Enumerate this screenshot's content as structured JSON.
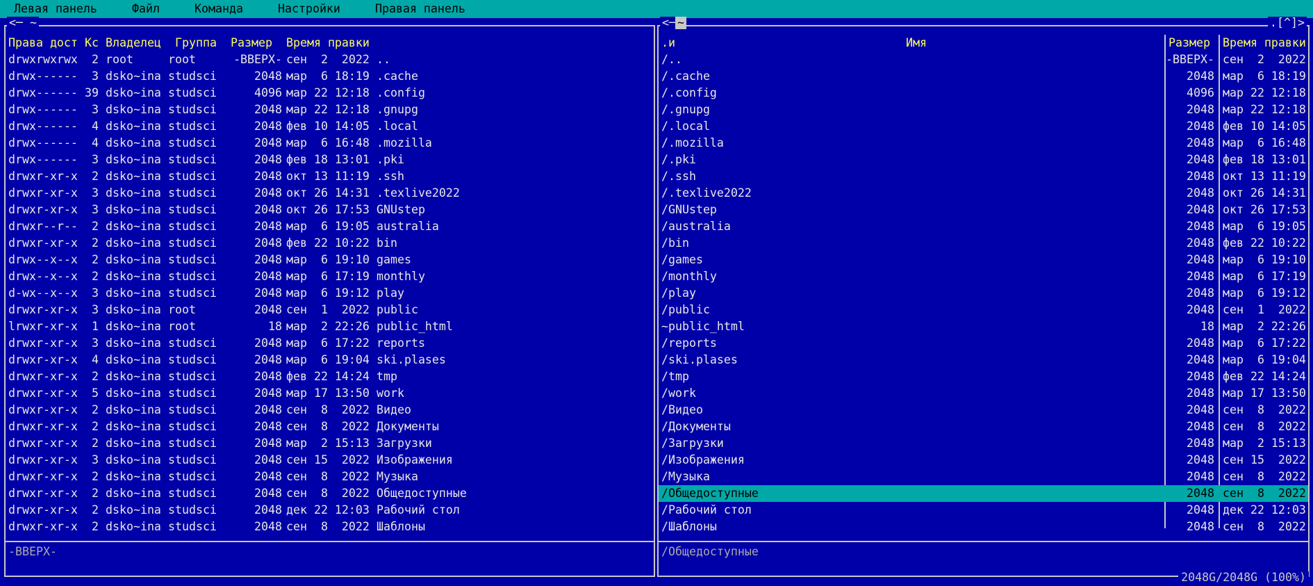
{
  "menubar": {
    "items": [
      "Левая панель",
      "Файл",
      "Команда",
      "Настройки",
      "Правая панель"
    ]
  },
  "left_panel": {
    "title": "<─ ~",
    "headers": {
      "perms": "Права дост",
      "links": "Кс",
      "owner": "Владелец",
      "group": "Группа",
      "size": "Размер",
      "mtime": "Время правки"
    },
    "rows": [
      {
        "perms": "drwxrwxrwx",
        "links": "2",
        "owner": "root",
        "group": "root",
        "size": "-ВВЕРХ-",
        "date": "сен  2  2022",
        "name": ".."
      },
      {
        "perms": "drwx------",
        "links": "3",
        "owner": "dsko~ina",
        "group": "studsci",
        "size": "2048",
        "date": "мар  6 18:19",
        "name": ".cache"
      },
      {
        "perms": "drwx------",
        "links": "39",
        "owner": "dsko~ina",
        "group": "studsci",
        "size": "4096",
        "date": "мар 22 12:18",
        "name": ".config"
      },
      {
        "perms": "drwx------",
        "links": "3",
        "owner": "dsko~ina",
        "group": "studsci",
        "size": "2048",
        "date": "мар 22 12:18",
        "name": ".gnupg"
      },
      {
        "perms": "drwx------",
        "links": "4",
        "owner": "dsko~ina",
        "group": "studsci",
        "size": "2048",
        "date": "фев 10 14:05",
        "name": ".local"
      },
      {
        "perms": "drwx------",
        "links": "4",
        "owner": "dsko~ina",
        "group": "studsci",
        "size": "2048",
        "date": "мар  6 16:48",
        "name": ".mozilla"
      },
      {
        "perms": "drwx------",
        "links": "3",
        "owner": "dsko~ina",
        "group": "studsci",
        "size": "2048",
        "date": "фев 18 13:01",
        "name": ".pki"
      },
      {
        "perms": "drwxr-xr-x",
        "links": "2",
        "owner": "dsko~ina",
        "group": "studsci",
        "size": "2048",
        "date": "окт 13 11:19",
        "name": ".ssh"
      },
      {
        "perms": "drwxr-xr-x",
        "links": "3",
        "owner": "dsko~ina",
        "group": "studsci",
        "size": "2048",
        "date": "окт 26 14:31",
        "name": ".texlive2022"
      },
      {
        "perms": "drwxr-xr-x",
        "links": "3",
        "owner": "dsko~ina",
        "group": "studsci",
        "size": "2048",
        "date": "окт 26 17:53",
        "name": "GNUstep"
      },
      {
        "perms": "drwxr--r--",
        "links": "2",
        "owner": "dsko~ina",
        "group": "studsci",
        "size": "2048",
        "date": "мар  6 19:05",
        "name": "australia"
      },
      {
        "perms": "drwxr-xr-x",
        "links": "2",
        "owner": "dsko~ina",
        "group": "studsci",
        "size": "2048",
        "date": "фев 22 10:22",
        "name": "bin"
      },
      {
        "perms": "drwx--x--x",
        "links": "2",
        "owner": "dsko~ina",
        "group": "studsci",
        "size": "2048",
        "date": "мар  6 19:10",
        "name": "games"
      },
      {
        "perms": "drwx--x--x",
        "links": "2",
        "owner": "dsko~ina",
        "group": "studsci",
        "size": "2048",
        "date": "мар  6 17:19",
        "name": "monthly"
      },
      {
        "perms": "d-wx--x--x",
        "links": "3",
        "owner": "dsko~ina",
        "group": "studsci",
        "size": "2048",
        "date": "мар  6 19:12",
        "name": "play"
      },
      {
        "perms": "drwxr-xr-x",
        "links": "3",
        "owner": "dsko~ina",
        "group": "root",
        "size": "2048",
        "date": "сен  1  2022",
        "name": "public"
      },
      {
        "perms": "lrwxr-xr-x",
        "links": "1",
        "owner": "dsko~ina",
        "group": "root",
        "size": "18",
        "date": "мар  2 22:26",
        "name": "public_html"
      },
      {
        "perms": "drwxr-xr-x",
        "links": "3",
        "owner": "dsko~ina",
        "group": "studsci",
        "size": "2048",
        "date": "мар  6 17:22",
        "name": "reports"
      },
      {
        "perms": "drwxr-xr-x",
        "links": "4",
        "owner": "dsko~ina",
        "group": "studsci",
        "size": "2048",
        "date": "мар  6 19:04",
        "name": "ski.plases"
      },
      {
        "perms": "drwxr-xr-x",
        "links": "2",
        "owner": "dsko~ina",
        "group": "studsci",
        "size": "2048",
        "date": "фев 22 14:24",
        "name": "tmp"
      },
      {
        "perms": "drwxr-xr-x",
        "links": "5",
        "owner": "dsko~ina",
        "group": "studsci",
        "size": "2048",
        "date": "мар 17 13:50",
        "name": "work"
      },
      {
        "perms": "drwxr-xr-x",
        "links": "2",
        "owner": "dsko~ina",
        "group": "studsci",
        "size": "2048",
        "date": "сен  8  2022",
        "name": "Видео"
      },
      {
        "perms": "drwxr-xr-x",
        "links": "2",
        "owner": "dsko~ina",
        "group": "studsci",
        "size": "2048",
        "date": "сен  8  2022",
        "name": "Документы"
      },
      {
        "perms": "drwxr-xr-x",
        "links": "2",
        "owner": "dsko~ina",
        "group": "studsci",
        "size": "2048",
        "date": "мар  2 15:13",
        "name": "Загрузки"
      },
      {
        "perms": "drwxr-xr-x",
        "links": "3",
        "owner": "dsko~ina",
        "group": "studsci",
        "size": "2048",
        "date": "сен 15  2022",
        "name": "Изображения"
      },
      {
        "perms": "drwxr-xr-x",
        "links": "2",
        "owner": "dsko~ina",
        "group": "studsci",
        "size": "2048",
        "date": "сен  8  2022",
        "name": "Музыка"
      },
      {
        "perms": "drwxr-xr-x",
        "links": "2",
        "owner": "dsko~ina",
        "group": "studsci",
        "size": "2048",
        "date": "сен  8  2022",
        "name": "Общедоступные"
      },
      {
        "perms": "drwxr-xr-x",
        "links": "2",
        "owner": "dsko~ina",
        "group": "studsci",
        "size": "2048",
        "date": "дек 22 12:03",
        "name": "Рабочий стол"
      },
      {
        "perms": "drwxr-xr-x",
        "links": "2",
        "owner": "dsko~ina",
        "group": "studsci",
        "size": "2048",
        "date": "сен  8  2022",
        "name": "Шаблоны"
      }
    ],
    "mini_status": "-ВВЕРХ-"
  },
  "right_panel": {
    "title_prefix": "<─",
    "title_path": "~",
    "corner": ".[^]>",
    "headers": {
      "sort": ".и",
      "name": "Имя",
      "size": "Размер",
      "mtime": "Время правки"
    },
    "rows": [
      {
        "name": "/..",
        "size": "-ВВЕРХ-",
        "date": "сен  2  2022"
      },
      {
        "name": "/.cache",
        "size": "2048",
        "date": "мар  6 18:19"
      },
      {
        "name": "/.config",
        "size": "4096",
        "date": "мар 22 12:18"
      },
      {
        "name": "/.gnupg",
        "size": "2048",
        "date": "мар 22 12:18"
      },
      {
        "name": "/.local",
        "size": "2048",
        "date": "фев 10 14:05"
      },
      {
        "name": "/.mozilla",
        "size": "2048",
        "date": "мар  6 16:48"
      },
      {
        "name": "/.pki",
        "size": "2048",
        "date": "фев 18 13:01"
      },
      {
        "name": "/.ssh",
        "size": "2048",
        "date": "окт 13 11:19"
      },
      {
        "name": "/.texlive2022",
        "size": "2048",
        "date": "окт 26 14:31"
      },
      {
        "name": "/GNUstep",
        "size": "2048",
        "date": "окт 26 17:53"
      },
      {
        "name": "/australia",
        "size": "2048",
        "date": "мар  6 19:05"
      },
      {
        "name": "/bin",
        "size": "2048",
        "date": "фев 22 10:22"
      },
      {
        "name": "/games",
        "size": "2048",
        "date": "мар  6 19:10"
      },
      {
        "name": "/monthly",
        "size": "2048",
        "date": "мар  6 17:19"
      },
      {
        "name": "/play",
        "size": "2048",
        "date": "мар  6 19:12"
      },
      {
        "name": "/public",
        "size": "2048",
        "date": "сен  1  2022"
      },
      {
        "name": "~public_html",
        "size": "18",
        "date": "мар  2 22:26"
      },
      {
        "name": "/reports",
        "size": "2048",
        "date": "мар  6 17:22"
      },
      {
        "name": "/ski.plases",
        "size": "2048",
        "date": "мар  6 19:04"
      },
      {
        "name": "/tmp",
        "size": "2048",
        "date": "фев 22 14:24"
      },
      {
        "name": "/work",
        "size": "2048",
        "date": "мар 17 13:50"
      },
      {
        "name": "/Видео",
        "size": "2048",
        "date": "сен  8  2022"
      },
      {
        "name": "/Документы",
        "size": "2048",
        "date": "сен  8  2022"
      },
      {
        "name": "/Загрузки",
        "size": "2048",
        "date": "мар  2 15:13"
      },
      {
        "name": "/Изображения",
        "size": "2048",
        "date": "сен 15  2022"
      },
      {
        "name": "/Музыка",
        "size": "2048",
        "date": "сен  8  2022"
      },
      {
        "name": "/Общедоступные",
        "size": "2048",
        "date": "сен  8  2022",
        "selected": true
      },
      {
        "name": "/Рабочий стол",
        "size": "2048",
        "date": "дек 22 12:03"
      },
      {
        "name": "/Шаблоны",
        "size": "2048",
        "date": "сен  8  2022"
      }
    ],
    "mini_status": "/Общедоступные",
    "disk_info": "2048G/2048G (100%)"
  },
  "colors": {
    "panel_bg": "#0000a8",
    "menubar_bg": "#00a8a8",
    "header_text": "#ffff55",
    "selected_bg": "#00a8a8",
    "border": "#c8c8c8"
  }
}
